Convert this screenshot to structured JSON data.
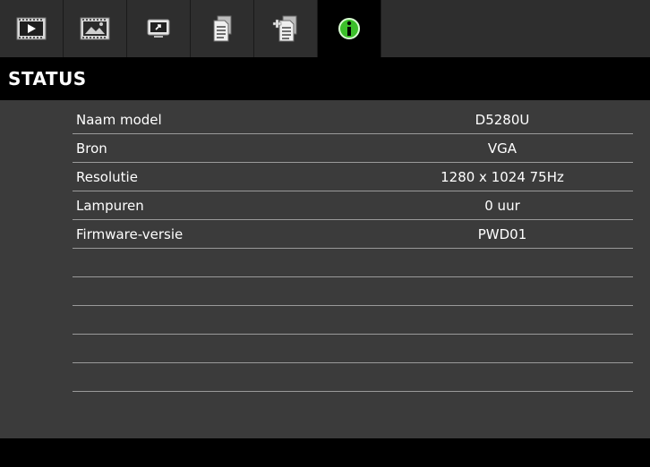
{
  "tabs": [
    {
      "icon": "video-play-icon",
      "active": false
    },
    {
      "icon": "image-icon",
      "active": false
    },
    {
      "icon": "screen-settings-icon",
      "active": false
    },
    {
      "icon": "document-settings-icon",
      "active": false
    },
    {
      "icon": "document-plus-icon",
      "active": false
    },
    {
      "icon": "info-icon",
      "active": true
    }
  ],
  "header": {
    "title": "STATUS"
  },
  "status_rows": [
    {
      "label": "Naam model",
      "value": "D5280U"
    },
    {
      "label": "Bron",
      "value": "VGA"
    },
    {
      "label": "Resolutie",
      "value": "1280 x 1024 75Hz"
    },
    {
      "label": "Lampuren",
      "value": "0 uur"
    },
    {
      "label": "Firmware-versie",
      "value": "PWD01"
    }
  ],
  "colors": {
    "accent_info": "#3cbf2a",
    "background": "#3b3b3b",
    "header": "#000000"
  }
}
